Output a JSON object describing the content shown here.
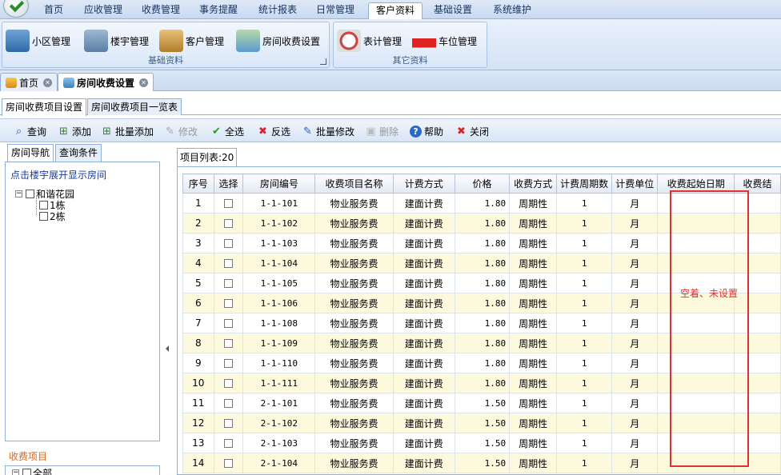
{
  "menu": {
    "items": [
      {
        "label": "首页"
      },
      {
        "label": "应收管理"
      },
      {
        "label": "收费管理"
      },
      {
        "label": "事务提醒"
      },
      {
        "label": "统计报表"
      },
      {
        "label": "日常管理"
      },
      {
        "label": "客户资料",
        "active": true
      },
      {
        "label": "基础设置"
      },
      {
        "label": "系统维护"
      }
    ]
  },
  "ribbon": {
    "group1": {
      "caption": "基础资料",
      "buttons": [
        "小区管理",
        "楼宇管理",
        "客户管理",
        "房间收费设置"
      ]
    },
    "group2": {
      "caption": "其它资料",
      "buttons": [
        "表计管理",
        "车位管理"
      ]
    }
  },
  "doc_tabs": [
    {
      "label": "首页"
    },
    {
      "label": "房间收费设置",
      "active": true
    }
  ],
  "sub_tabs": [
    "房间收费项目设置",
    "房间收费项目一览表"
  ],
  "toolbar": {
    "buttons": [
      {
        "label": "查询",
        "icon": "search-icon"
      },
      {
        "label": "添加",
        "icon": "add-icon"
      },
      {
        "label": "批量添加",
        "icon": "batch-add-icon"
      },
      {
        "label": "修改",
        "icon": "edit-icon",
        "disabled": true
      },
      {
        "label": "全选",
        "icon": "check-icon"
      },
      {
        "label": "反选",
        "icon": "cross-icon"
      },
      {
        "label": "批量修改",
        "icon": "batch-edit-icon"
      },
      {
        "label": "删除",
        "icon": "delete-icon",
        "disabled": true
      },
      {
        "label": "帮助",
        "icon": "help-icon"
      },
      {
        "label": "关闭",
        "icon": "close-icon"
      }
    ]
  },
  "left": {
    "tabs": [
      "房间导航",
      "查询条件"
    ],
    "hint": "点击楼宇展开显示房间",
    "tree": {
      "root": "和谐花园",
      "children": [
        "1栋",
        "2栋"
      ]
    },
    "fee_label": "收费项目",
    "fee_root": "全部"
  },
  "grid": {
    "tab_label": "项目列表:20",
    "columns": [
      "序号",
      "选择",
      "房间编号",
      "收费项目名称",
      "计费方式",
      "价格",
      "收费方式",
      "计费周期数",
      "计费单位",
      "收费起始日期",
      "收费结"
    ],
    "rows": [
      [
        "1",
        "1-1-101",
        "物业服务费",
        "建面计费",
        "1.80",
        "周期性",
        "1",
        "月"
      ],
      [
        "2",
        "1-1-102",
        "物业服务费",
        "建面计费",
        "1.80",
        "周期性",
        "1",
        "月"
      ],
      [
        "3",
        "1-1-103",
        "物业服务费",
        "建面计费",
        "1.80",
        "周期性",
        "1",
        "月"
      ],
      [
        "4",
        "1-1-104",
        "物业服务费",
        "建面计费",
        "1.80",
        "周期性",
        "1",
        "月"
      ],
      [
        "5",
        "1-1-105",
        "物业服务费",
        "建面计费",
        "1.80",
        "周期性",
        "1",
        "月"
      ],
      [
        "6",
        "1-1-106",
        "物业服务费",
        "建面计费",
        "1.80",
        "周期性",
        "1",
        "月"
      ],
      [
        "7",
        "1-1-108",
        "物业服务费",
        "建面计费",
        "1.80",
        "周期性",
        "1",
        "月"
      ],
      [
        "8",
        "1-1-109",
        "物业服务费",
        "建面计费",
        "1.80",
        "周期性",
        "1",
        "月"
      ],
      [
        "9",
        "1-1-110",
        "物业服务费",
        "建面计费",
        "1.80",
        "周期性",
        "1",
        "月"
      ],
      [
        "10",
        "1-1-111",
        "物业服务费",
        "建面计费",
        "1.80",
        "周期性",
        "1",
        "月"
      ],
      [
        "11",
        "2-1-101",
        "物业服务费",
        "建面计费",
        "1.50",
        "周期性",
        "1",
        "月"
      ],
      [
        "12",
        "2-1-102",
        "物业服务费",
        "建面计费",
        "1.50",
        "周期性",
        "1",
        "月"
      ],
      [
        "13",
        "2-1-103",
        "物业服务费",
        "建面计费",
        "1.50",
        "周期性",
        "1",
        "月"
      ],
      [
        "14",
        "2-1-104",
        "物业服务费",
        "建面计费",
        "1.50",
        "周期性",
        "1",
        "月"
      ]
    ]
  },
  "annotation": {
    "text": "空着、未设置",
    "color": "#e03030"
  }
}
